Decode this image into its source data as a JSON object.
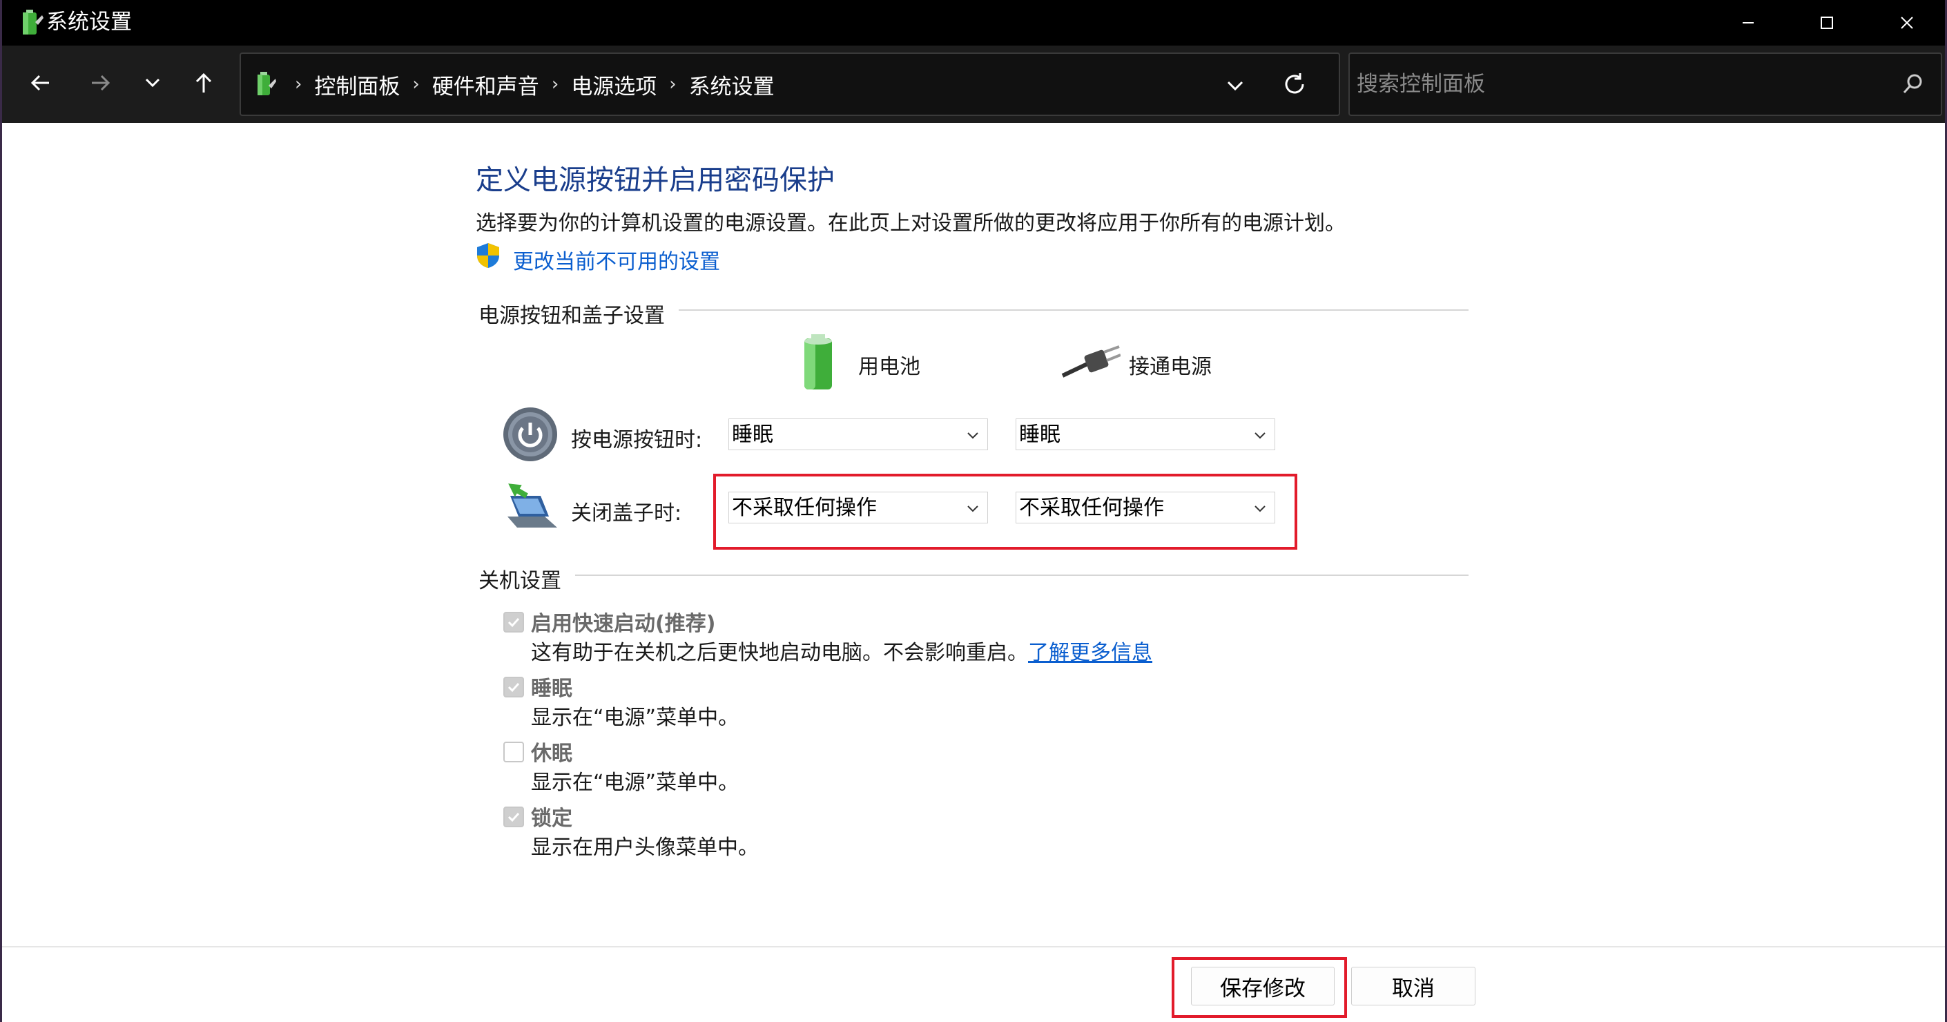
{
  "window": {
    "title": "系统设置"
  },
  "nav": {
    "breadcrumbs": [
      "控制面板",
      "硬件和声音",
      "电源选项",
      "系统设置"
    ],
    "search_placeholder": "搜索控制面板"
  },
  "page": {
    "title": "定义电源按钮并启用密码保护",
    "description": "选择要为你的计算机设置的电源设置。在此页上对设置所做的更改将应用于你所有的电源计划。",
    "change_link": "更改当前不可用的设置"
  },
  "power_section": {
    "heading": "电源按钮和盖子设置",
    "col_battery": "用电池",
    "col_plugged": "接通电源",
    "rows": [
      {
        "label": "按电源按钮时:",
        "battery": "睡眠",
        "plugged": "睡眠"
      },
      {
        "label": "关闭盖子时:",
        "battery": "不采取任何操作",
        "plugged": "不采取任何操作"
      }
    ]
  },
  "shutdown_section": {
    "heading": "关机设置",
    "items": [
      {
        "label": "启用快速启动(推荐)",
        "desc": "这有助于在关机之后更快地启动电脑。不会影响重启。",
        "link": "了解更多信息",
        "checked": true
      },
      {
        "label": "睡眠",
        "desc": "显示在“电源”菜单中。",
        "checked": true
      },
      {
        "label": "休眠",
        "desc": "显示在“电源”菜单中。",
        "checked": false
      },
      {
        "label": "锁定",
        "desc": "显示在用户头像菜单中。",
        "checked": true
      }
    ]
  },
  "footer": {
    "save": "保存修改",
    "cancel": "取消"
  },
  "colors": {
    "accent_title": "#1a3e8c",
    "link": "#0a5ecf",
    "highlight_box": "#e21b2b"
  }
}
